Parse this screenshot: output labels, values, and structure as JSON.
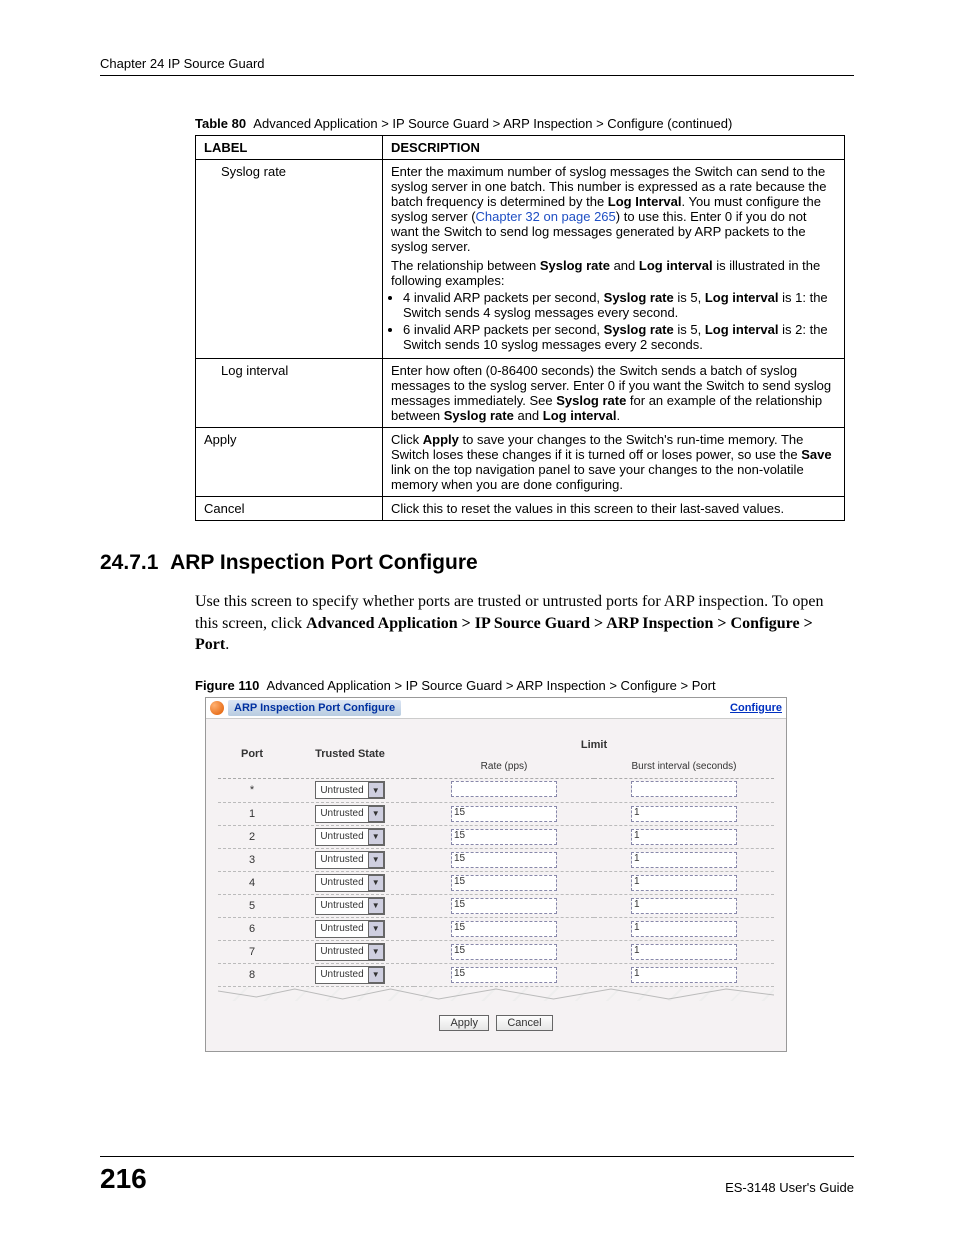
{
  "header": {
    "chapter": "Chapter 24 IP Source Guard"
  },
  "table": {
    "caption_label": "Table 80",
    "caption_text": "Advanced Application > IP Source Guard > ARP Inspection > Configure (continued)",
    "head_label": "LABEL",
    "head_desc": "DESCRIPTION",
    "rows": {
      "syslog_rate": {
        "label": "Syslog rate",
        "p1a": "Enter the maximum number of syslog messages the Switch can send to the syslog server in one batch. This number is expressed as a rate because the batch frequency is determined by the ",
        "p1b_bold": "Log Interval",
        "p1c": ". You must configure the syslog server (",
        "p1d_link": "Chapter 32 on page 265",
        "p1e": ") to use this. Enter 0 if you do not want the Switch to send log messages generated by ARP packets to the syslog server.",
        "p2a": "The relationship between ",
        "p2b_bold": "Syslog rate",
        "p2c": " and ",
        "p2d_bold": "Log interval",
        "p2e": " is illustrated in the following examples:",
        "li1a": "4 invalid ARP packets per second, ",
        "li1b_bold": "Syslog rate",
        "li1c": " is 5, ",
        "li1d_bold": "Log interval",
        "li1e": " is 1: the Switch sends 4 syslog messages every second.",
        "li2a": "6 invalid ARP packets per second, ",
        "li2b_bold": "Syslog rate",
        "li2c": " is 5, ",
        "li2d_bold": "Log interval",
        "li2e": " is 2: the Switch sends 10 syslog messages every 2 seconds."
      },
      "log_interval": {
        "label": "Log interval",
        "a": "Enter how often (0-86400 seconds) the Switch sends a batch of syslog messages to the syslog server. Enter 0 if you want the Switch to send syslog messages immediately. See ",
        "b_bold": "Syslog rate",
        "c": " for an example of the relationship between ",
        "d_bold": "Syslog rate",
        "e": " and ",
        "f_bold": "Log interval",
        "g": "."
      },
      "apply": {
        "label": "Apply",
        "a": "Click ",
        "b_bold": "Apply",
        "c": " to save your changes to the Switch's run-time memory. The Switch loses these changes if it is turned off or loses power, so use the ",
        "d_bold": "Save",
        "e": " link on the top navigation panel to save your changes to the non-volatile memory when you are done configuring."
      },
      "cancel": {
        "label": "Cancel",
        "text": "Click this to reset the values in this screen to their last-saved values."
      }
    }
  },
  "section": {
    "number": "24.7.1",
    "title": "ARP Inspection Port Configure",
    "body_a": "Use this screen to specify whether ports are trusted or untrusted ports for ARP inspection. To open this screen, click ",
    "body_b_bold": "Advanced Application > IP Source Guard > ARP Inspection > Configure > Port",
    "body_c": "."
  },
  "figure": {
    "label": "Figure 110",
    "caption": "Advanced Application > IP Source Guard > ARP Inspection > Configure > Port",
    "panel_title": "ARP Inspection Port Configure",
    "configure_link": "Configure",
    "col_port": "Port",
    "col_trusted": "Trusted State",
    "col_limit": "Limit",
    "col_rate": "Rate (pps)",
    "col_burst": "Burst interval (seconds)",
    "select_value": "Untrusted",
    "rows": [
      {
        "port": "*",
        "rate": "",
        "burst": ""
      },
      {
        "port": "1",
        "rate": "15",
        "burst": "1"
      },
      {
        "port": "2",
        "rate": "15",
        "burst": "1"
      },
      {
        "port": "3",
        "rate": "15",
        "burst": "1"
      },
      {
        "port": "4",
        "rate": "15",
        "burst": "1"
      },
      {
        "port": "5",
        "rate": "15",
        "burst": "1"
      },
      {
        "port": "6",
        "rate": "15",
        "burst": "1"
      },
      {
        "port": "7",
        "rate": "15",
        "burst": "1"
      },
      {
        "port": "8",
        "rate": "15",
        "burst": "1"
      }
    ],
    "btn_apply": "Apply",
    "btn_cancel": "Cancel"
  },
  "footer": {
    "page": "216",
    "guide": "ES-3148 User's Guide"
  }
}
